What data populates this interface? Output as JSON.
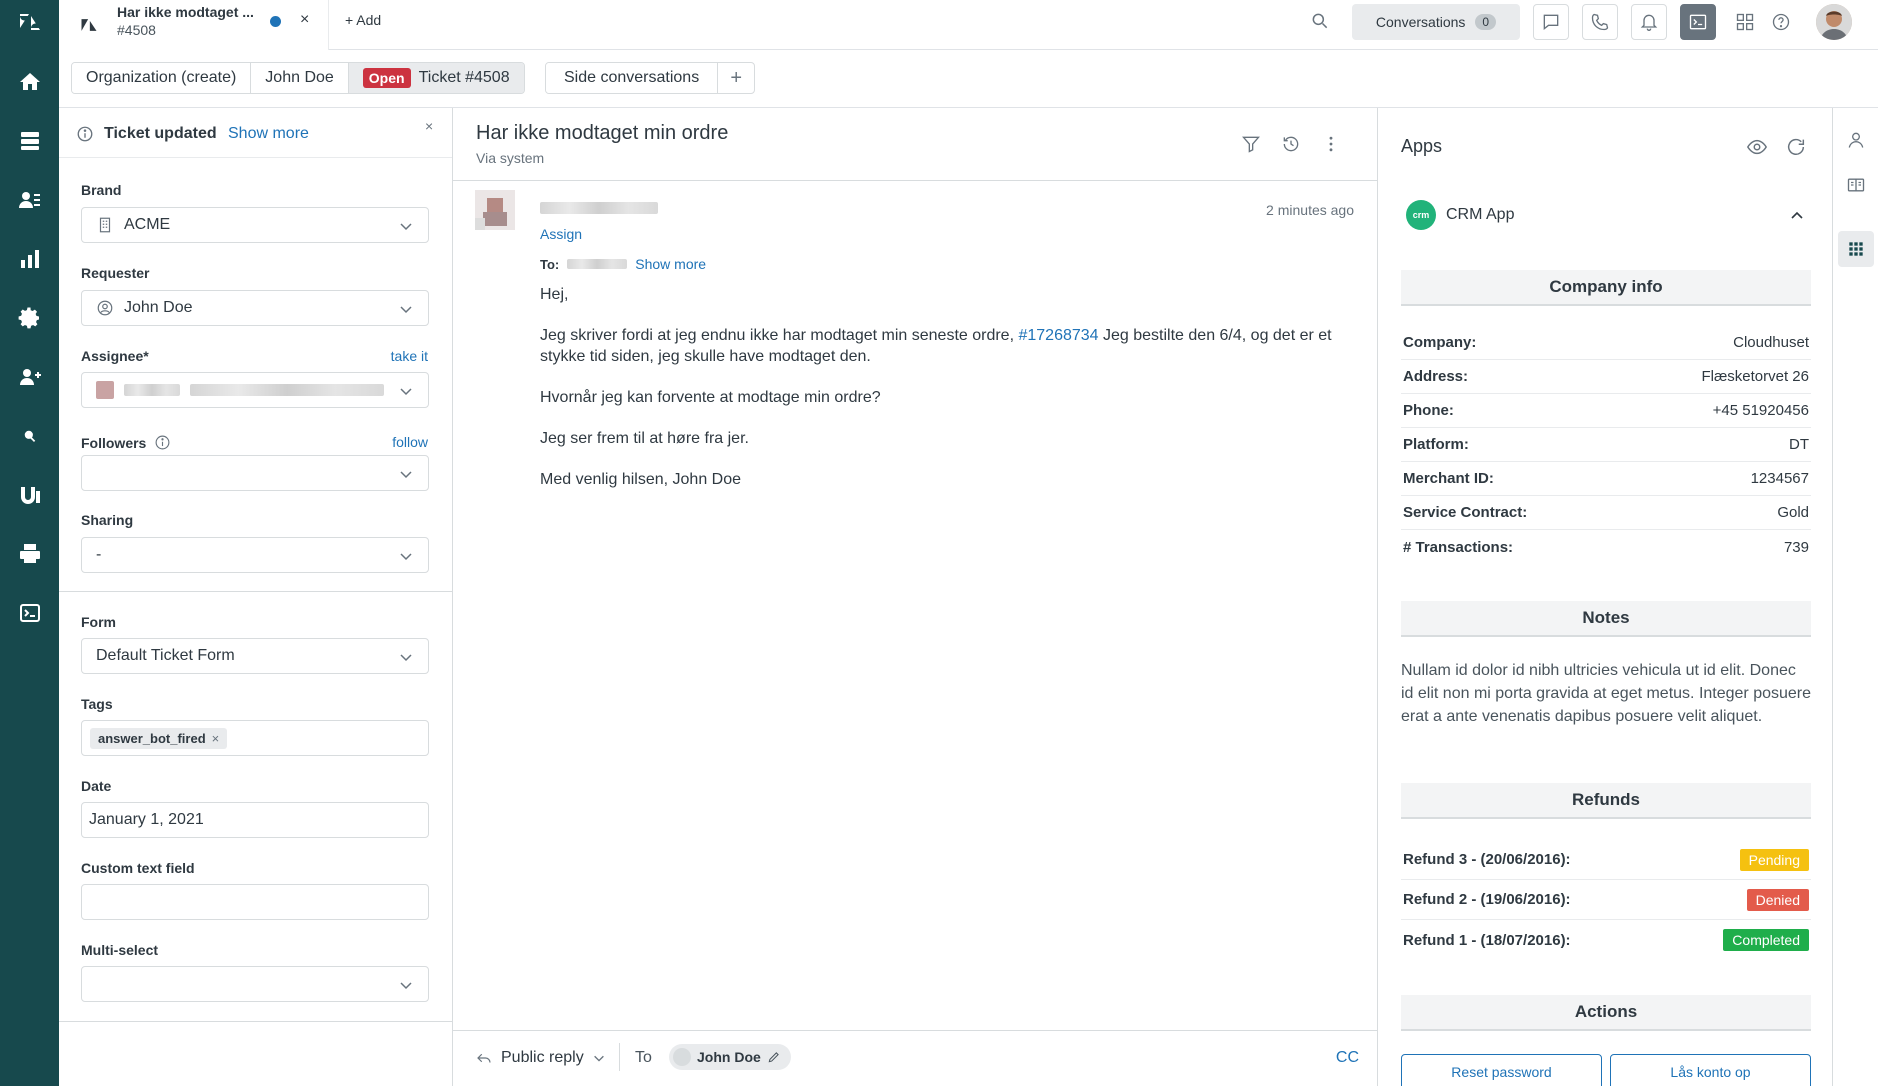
{
  "tab": {
    "title": "Har ikke modtaget ...",
    "subtitle": "#4508",
    "close": "×",
    "add_label": "+ Add"
  },
  "topbar": {
    "conversations_label": "Conversations",
    "conversations_count": "0"
  },
  "breadcrumbs": {
    "items": [
      "Organization (create)",
      "John Doe"
    ],
    "status": "Open",
    "ticket": "Ticket #4508",
    "side": "Side conversations",
    "plus": "+"
  },
  "notice": {
    "title": "Ticket updated",
    "more": "Show more",
    "close": "×"
  },
  "fields": {
    "brand_label": "Brand",
    "brand_value": "ACME",
    "requester_label": "Requester",
    "requester_value": "John Doe",
    "assignee_label": "Assignee*",
    "assignee_link": "take it",
    "followers_label": "Followers",
    "followers_link": "follow",
    "sharing_label": "Sharing",
    "sharing_value": "-",
    "form_label": "Form",
    "form_value": "Default Ticket Form",
    "tags_label": "Tags",
    "tag_value": "answer_bot_fired",
    "tag_remove": "×",
    "date_label": "Date",
    "date_value": "January 1, 2021",
    "custom_label": "Custom text field",
    "multi_label": "Multi-select"
  },
  "ticket": {
    "title": "Har ikke modtaget min ordre",
    "via": "Via system",
    "time": "2 minutes ago",
    "assign": "Assign",
    "to_label": "To:",
    "show_more": "Show more",
    "body": {
      "greeting": "Hej,",
      "p1_before": "Jeg skriver fordi at jeg endnu ikke har modtaget min seneste ordre, ",
      "p1_link": "#17268734",
      "p1_after": " Jeg bestilte den 6/4, og det er et stykke tid siden, jeg skulle have modtaget den.",
      "p2": "Hvornår jeg kan forvente at modtage min ordre?",
      "p3": "Jeg ser frem til at høre fra jer.",
      "p4": "Med venlig hilsen, John Doe"
    }
  },
  "composer": {
    "reply_type": "Public reply",
    "to_label": "To",
    "recipient": "John Doe",
    "cc": "CC"
  },
  "apps": {
    "title": "Apps",
    "crm_logo": "crm",
    "crm_name": "CRM App",
    "company_header": "Company info",
    "company": [
      {
        "k": "Company:",
        "v": "Cloudhuset"
      },
      {
        "k": "Address:",
        "v": "Flæsketorvet 26"
      },
      {
        "k": "Phone:",
        "v": "+45 51920456"
      },
      {
        "k": "Platform:",
        "v": "DT"
      },
      {
        "k": "Merchant ID:",
        "v": "1234567"
      },
      {
        "k": "Service Contract:",
        "v": "Gold"
      },
      {
        "k": "# Transactions:",
        "v": "739"
      }
    ],
    "notes_header": "Notes",
    "notes": "Nullam id dolor id nibh ultricies vehicula ut id elit. Donec id elit non mi porta gravida at eget metus. Integer posuere erat a ante venenatis dapibus posuere velit aliquet.",
    "refunds_header": "Refunds",
    "refunds": [
      {
        "k": "Refund 3 - (20/06/2016):",
        "status": "Pending",
        "color": "#f5c110"
      },
      {
        "k": "Refund 2 - (19/06/2016):",
        "status": "Denied",
        "color": "#e35b4b"
      },
      {
        "k": "Refund 1 - (18/07/2016):",
        "status": "Completed",
        "color": "#1fae4b"
      }
    ],
    "actions_header": "Actions",
    "action_reset": "Reset password",
    "action_lock": "Lås konto op"
  },
  "colors": {
    "nav": "#17494d",
    "link": "#1f73b7",
    "open_badge": "#cc3340",
    "crm": "#21b37a"
  }
}
